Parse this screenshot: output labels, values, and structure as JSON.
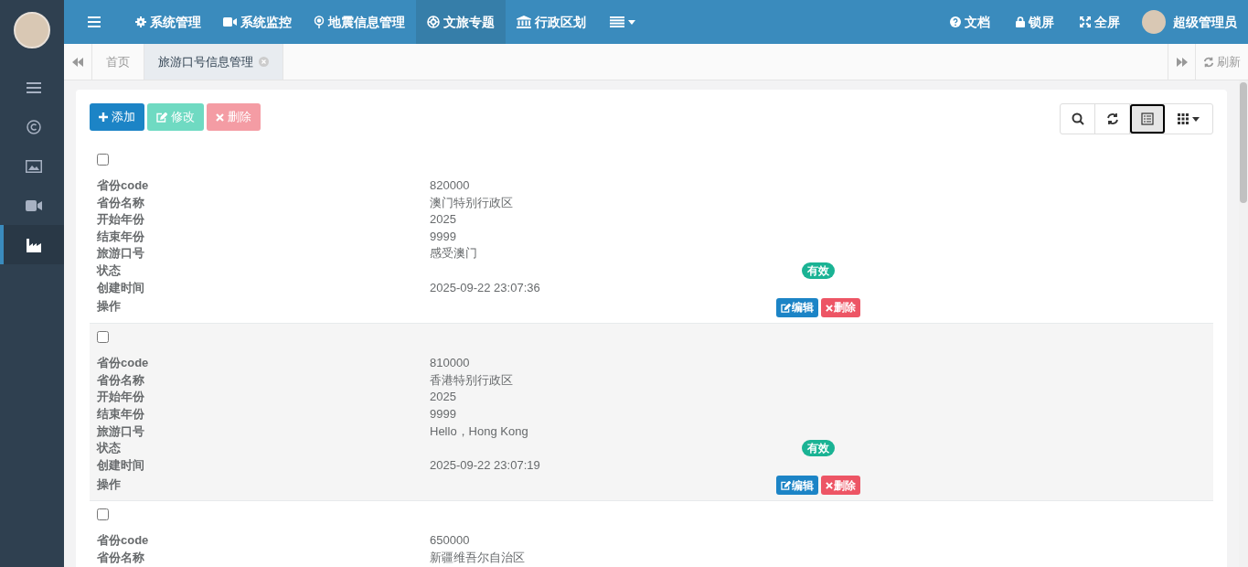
{
  "sidebar": {
    "items": [
      {
        "selected": false
      },
      {
        "selected": false
      },
      {
        "selected": false
      },
      {
        "selected": false
      },
      {
        "selected": true
      }
    ]
  },
  "top_nav": {
    "items": [
      {
        "label": "系统管理",
        "selected": false
      },
      {
        "label": "系统监控",
        "selected": false
      },
      {
        "label": "地震信息管理",
        "selected": false
      },
      {
        "label": "文旅专题",
        "selected": true
      },
      {
        "label": "行政区划",
        "selected": false
      }
    ],
    "right_items": [
      {
        "label": "文档"
      },
      {
        "label": "锁屏"
      },
      {
        "label": "全屏"
      }
    ],
    "user": "超级管理员"
  },
  "tabs": [
    {
      "label": "首页",
      "selected": false
    },
    {
      "label": "旅游口号信息管理",
      "selected": true
    }
  ],
  "refresh": "刷新",
  "toolbar": {
    "buttons": [
      {
        "label": "添加",
        "disabled": false
      },
      {
        "label": "修改",
        "disabled": true
      },
      {
        "label": "删除",
        "disabled": true
      }
    ],
    "card_view": {
      "selected": true
    }
  },
  "rows": [
    {
      "checked": false,
      "fields": [
        {
          "label": "省份code",
          "kind": "text",
          "value": "820000"
        },
        {
          "label": "省份名称",
          "kind": "text",
          "value": "澳门特别行政区"
        },
        {
          "label": "开始年份",
          "kind": "text",
          "value": "2025"
        },
        {
          "label": "结束年份",
          "kind": "text",
          "value": "9999"
        },
        {
          "label": "旅游口号",
          "kind": "text",
          "value": "感受澳门"
        },
        {
          "label": "状态",
          "kind": "status",
          "value": "有效"
        },
        {
          "label": "创建时间",
          "kind": "text",
          "value": "2025-09-22 23:07:36"
        },
        {
          "label": "操作",
          "kind": "actions",
          "buttons": [
            "编辑",
            "删除"
          ]
        }
      ]
    },
    {
      "checked": false,
      "fields": [
        {
          "label": "省份code",
          "kind": "text",
          "value": "810000"
        },
        {
          "label": "省份名称",
          "kind": "text",
          "value": "香港特别行政区"
        },
        {
          "label": "开始年份",
          "kind": "text",
          "value": "2025"
        },
        {
          "label": "结束年份",
          "kind": "text",
          "value": "9999"
        },
        {
          "label": "旅游口号",
          "kind": "text",
          "value": "Hello，Hong Kong"
        },
        {
          "label": "状态",
          "kind": "status",
          "value": "有效"
        },
        {
          "label": "创建时间",
          "kind": "text",
          "value": "2025-09-22 23:07:19"
        },
        {
          "label": "操作",
          "kind": "actions",
          "buttons": [
            "编辑",
            "删除"
          ]
        }
      ]
    },
    {
      "checked": false,
      "fields": [
        {
          "label": "省份code",
          "kind": "text",
          "value": "650000"
        },
        {
          "label": "省份名称",
          "kind": "text",
          "value": "新疆维吾尔自治区"
        }
      ]
    }
  ]
}
